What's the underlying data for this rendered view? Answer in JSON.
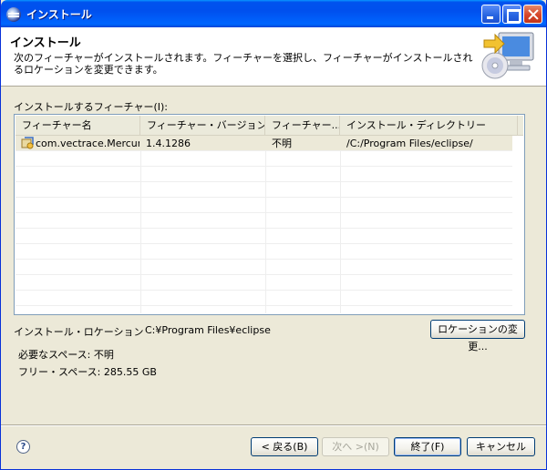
{
  "window": {
    "title": "インストール"
  },
  "banner": {
    "title": "インストール",
    "description": "次のフィーチャーがインストールされます。フィーチャーを選択し、フィーチャーがインストールされるロケーションを変更できます。"
  },
  "features_label": "インストールするフィーチャー(I):",
  "table": {
    "columns": [
      "フィーチャー名",
      "フィーチャー・バージョン",
      "フィーチャー...",
      "インストール・ディレクトリー"
    ],
    "rows": [
      {
        "name": "com.vectrace.Mercuri...",
        "version": "1.4.1286",
        "size": "不明",
        "directory": "/C:/Program Files/eclipse/"
      }
    ]
  },
  "location": {
    "label": "インストール・ロケーション",
    "value": "C:¥Program Files¥eclipse",
    "change_button": "ロケーションの変更..."
  },
  "space": {
    "required": "必要なスペース: 不明",
    "free": "フリー・スペース:  285.55 GB"
  },
  "buttons": {
    "back": "< 戻る(B)",
    "next": "次へ >(N)",
    "finish": "終了(F)",
    "cancel": "キャンセル"
  },
  "colors": {
    "titlebar": "#0053ee",
    "dialog_bg": "#ece9d8",
    "close_button": "#d6452b"
  },
  "icons": [
    "eclipse-icon",
    "install-banner-icon",
    "feature-icon",
    "help-icon"
  ]
}
